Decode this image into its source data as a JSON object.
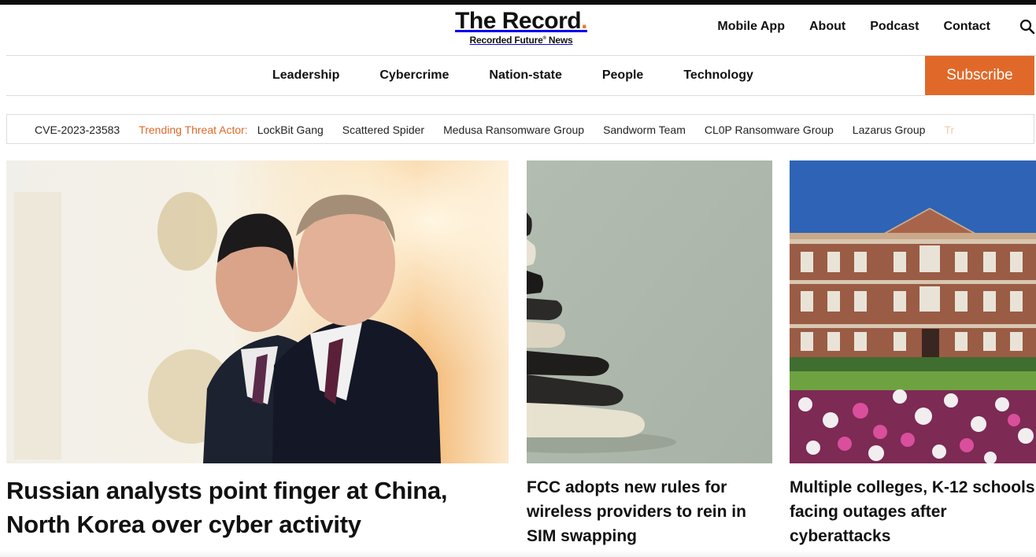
{
  "site": {
    "logo_main": "The Record",
    "logo_dot": ".",
    "logo_sub": "Recorded Future",
    "logo_sub_mark": "®",
    "logo_sub_tail": " News",
    "brand_color": "#e0692a"
  },
  "top_nav": {
    "links": [
      "Mobile App",
      "About",
      "Podcast",
      "Contact"
    ],
    "search_icon": "search-icon"
  },
  "category_nav": {
    "items": [
      "Leadership",
      "Cybercrime",
      "Nation-state",
      "People",
      "Technology"
    ],
    "subscribe_label": "Subscribe"
  },
  "trending": {
    "cve": "CVE-2023-23583",
    "label": "Trending Threat Actor:",
    "actors": [
      "LockBit Gang",
      "Scattered Spider",
      "Medusa Ransomware Group",
      "Sandworm Team",
      "CL0P Ransomware Group",
      "Lazarus Group"
    ],
    "overflow_fragment": "Tr"
  },
  "articles": [
    {
      "title": "Russian analysts point finger at China, North Korea over cyber activity"
    },
    {
      "title": "FCC adopts new rules for wireless providers to rein in SIM swapping"
    },
    {
      "title": "Multiple colleges, K-12 schools facing outages after cyberattacks"
    }
  ]
}
